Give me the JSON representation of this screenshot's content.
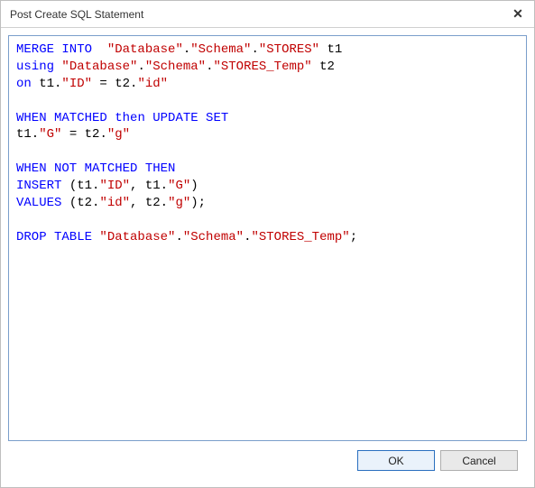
{
  "dialog": {
    "title": "Post Create SQL Statement"
  },
  "buttons": {
    "ok": "OK",
    "cancel": "Cancel"
  },
  "sql_tokens": [
    [
      [
        "kw",
        "MERGE INTO"
      ],
      [
        "",
        ""
      ],
      [
        "",
        "  "
      ],
      [
        "str",
        "\"Database\""
      ],
      [
        "",
        "."
      ],
      [
        "str",
        "\"Schema\""
      ],
      [
        "",
        "."
      ],
      [
        "str",
        "\"STORES\""
      ],
      [
        "",
        " t1"
      ]
    ],
    [
      [
        "kw",
        "using"
      ],
      [
        "",
        " "
      ],
      [
        "str",
        "\"Database\""
      ],
      [
        "",
        "."
      ],
      [
        "str",
        "\"Schema\""
      ],
      [
        "",
        "."
      ],
      [
        "str",
        "\"STORES_Temp\""
      ],
      [
        "",
        " t2"
      ]
    ],
    [
      [
        "kw",
        "on"
      ],
      [
        "",
        " t1."
      ],
      [
        "str",
        "\"ID\""
      ],
      [
        "",
        " = t2."
      ],
      [
        "str",
        "\"id\""
      ]
    ],
    [],
    [
      [
        "kw",
        "WHEN MATCHED"
      ],
      [
        "",
        " "
      ],
      [
        "kw",
        "then"
      ],
      [
        "",
        " "
      ],
      [
        "kw",
        "UPDATE SET"
      ]
    ],
    [
      [
        "",
        "t1."
      ],
      [
        "str",
        "\"G\""
      ],
      [
        "",
        " = t2."
      ],
      [
        "str",
        "\"g\""
      ]
    ],
    [],
    [
      [
        "kw",
        "WHEN NOT MATCHED THEN"
      ]
    ],
    [
      [
        "kw",
        "INSERT"
      ],
      [
        "",
        " (t1."
      ],
      [
        "str",
        "\"ID\""
      ],
      [
        "",
        ", t1."
      ],
      [
        "str",
        "\"G\""
      ],
      [
        "",
        ")"
      ]
    ],
    [
      [
        "kw",
        "VALUES"
      ],
      [
        "",
        " (t2."
      ],
      [
        "str",
        "\"id\""
      ],
      [
        "",
        ", t2."
      ],
      [
        "str",
        "\"g\""
      ],
      [
        "",
        ");"
      ]
    ],
    [],
    [
      [
        "kw",
        "DROP TABLE"
      ],
      [
        "",
        " "
      ],
      [
        "str",
        "\"Database\""
      ],
      [
        "",
        "."
      ],
      [
        "str",
        "\"Schema\""
      ],
      [
        "",
        "."
      ],
      [
        "str",
        "\"STORES_Temp\""
      ],
      [
        "",
        ";"
      ]
    ]
  ]
}
